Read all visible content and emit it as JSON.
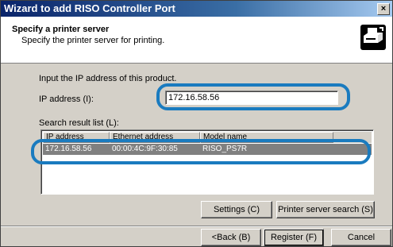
{
  "window": {
    "title": "Wizard to add RISO Controller Port",
    "close_glyph": "×"
  },
  "header": {
    "heading": "Specify a printer server",
    "subheading": "Specify the printer server for printing.",
    "icon": "printer-network-icon"
  },
  "form": {
    "instruction": "Input the IP address of this product.",
    "ip_label": "IP address (I):",
    "ip_value": "172.16.58.56",
    "list_label": "Search result list (L):"
  },
  "list": {
    "columns": [
      "IP address",
      "Ethernet address",
      "Model name"
    ],
    "rows": [
      {
        "ip": "172.16.58.56",
        "mac": "00:00:4C:9F:30:85",
        "model": "RISO_PS7R",
        "selected": true
      }
    ]
  },
  "buttons": {
    "settings": "Settings (C)",
    "search": "Printer server search (S)",
    "back": "<Back (B)",
    "register": "Register (F)",
    "cancel": "Cancel"
  },
  "colors": {
    "highlight": "#1a7bbf",
    "titlebar_start": "#0a246a",
    "dialog_bg": "#d4d0c8",
    "selected_row": "#808080"
  }
}
